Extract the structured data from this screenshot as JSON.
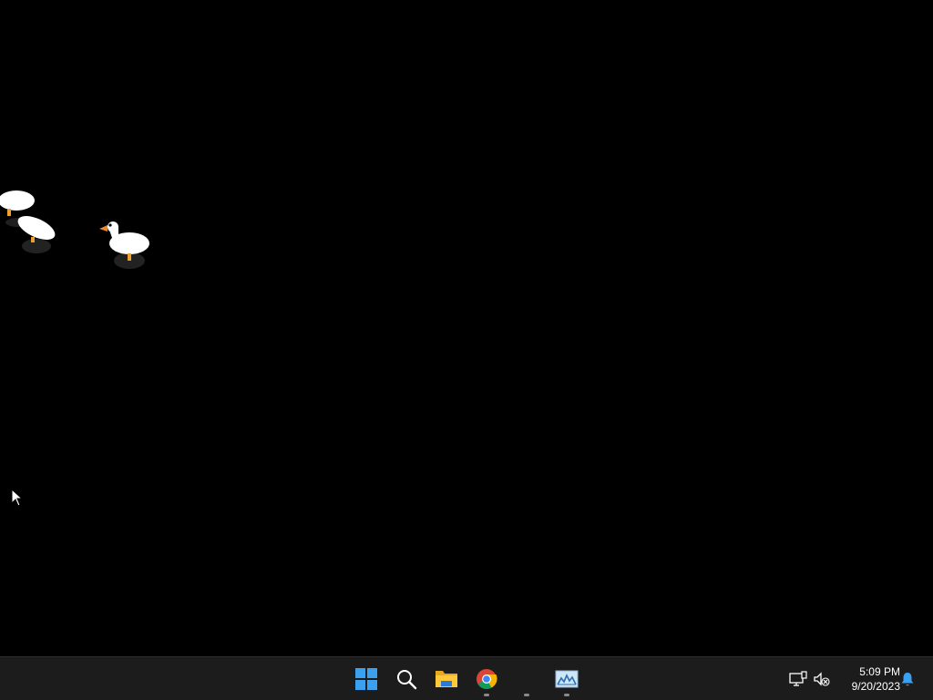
{
  "desktop": {
    "background_color": "#000000",
    "geese": [
      {
        "name": "goose-1",
        "state": "walking"
      },
      {
        "name": "goose-2",
        "state": "walking"
      },
      {
        "name": "goose-3",
        "state": "standing"
      }
    ]
  },
  "taskbar": {
    "background_color": "#1c1c1c",
    "apps": [
      {
        "name": "start-button",
        "icon": "windows-logo-icon",
        "running": false
      },
      {
        "name": "search-button",
        "icon": "search-icon",
        "running": false
      },
      {
        "name": "file-explorer-button",
        "icon": "folder-icon",
        "running": false
      },
      {
        "name": "chrome-button",
        "icon": "chrome-icon",
        "running": true
      },
      {
        "name": "hidden-app-button",
        "icon": "blank-icon",
        "running": true
      },
      {
        "name": "image-app-button",
        "icon": "picture-icon",
        "running": true
      }
    ],
    "tray": {
      "network_icon": "network-disconnected-icon",
      "volume_icon": "volume-muted-icon",
      "notification_icon": "bell-icon",
      "time": "5:09 PM",
      "date": "9/20/2023"
    }
  }
}
